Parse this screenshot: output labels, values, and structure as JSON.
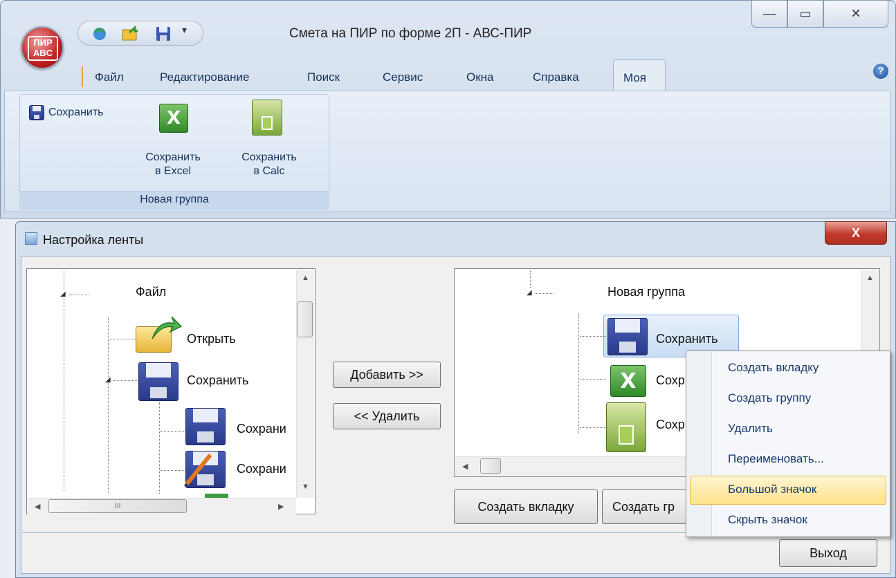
{
  "window": {
    "title": "Смета на ПИР по форме 2П - АВС-ПИР",
    "logo_text": "ПИР ABC",
    "min_glyph": "—",
    "max_glyph": "▭",
    "close_glyph": "✕"
  },
  "menu_tabs": [
    "Файл",
    "Редактирование",
    "Поиск",
    "Сервис",
    "Окна",
    "Справка",
    "Моя"
  ],
  "active_tab": "Моя",
  "help_glyph": "?",
  "ribbon": {
    "save_label": "Сохранить",
    "save_excel_line1": "Сохранить",
    "save_excel_line2": "в Excel",
    "save_calc_line1": "Сохранить",
    "save_calc_line2": "в Calc",
    "group_label": "Новая группа"
  },
  "dialog": {
    "title": "Настройка ленты",
    "close_glyph": "X",
    "left_tree": {
      "root": "Файл",
      "items": [
        "Открыть",
        "Сохранить",
        "Сохрани",
        "Сохрани"
      ]
    },
    "right_tree": {
      "root": "Новая группа",
      "items": [
        "Сохранить",
        "Сохр",
        "Сохр"
      ]
    },
    "add_button": "Добавить >>",
    "remove_button": "<< Удалить",
    "create_tab_button": "Создать вкладку",
    "create_group_button": "Создать гр",
    "exit_button": "Выход",
    "scroll_glyph": "III"
  },
  "context_menu": {
    "items": [
      "Создать вкладку",
      "Создать группу",
      "Удалить",
      "Переименовать...",
      "Большой значок",
      "Скрыть значок"
    ],
    "highlighted": "Большой значок"
  }
}
